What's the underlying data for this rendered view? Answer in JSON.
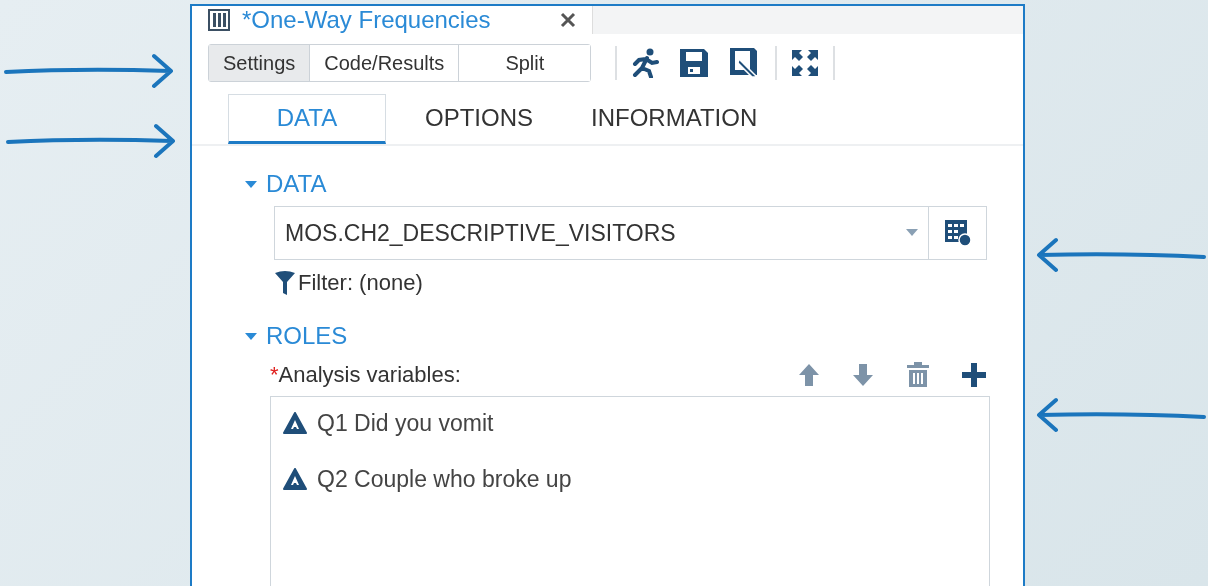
{
  "document_tab": {
    "title": "*One-Way Frequencies"
  },
  "view_buttons": [
    {
      "label": "Settings",
      "selected": true
    },
    {
      "label": "Code/Results",
      "selected": false
    },
    {
      "label": "Split",
      "selected": false
    }
  ],
  "tabs": [
    {
      "label": "DATA",
      "selected": true
    },
    {
      "label": "OPTIONS",
      "selected": false
    },
    {
      "label": "INFORMATION",
      "selected": false
    }
  ],
  "sections": [
    {
      "kind": "data",
      "title": "DATA",
      "expanded": true,
      "dataset": "MOS.CH2_DESCRIPTIVE_VISITORS",
      "filter": "Filter: (none)"
    },
    {
      "kind": "roles",
      "title": "ROLES",
      "expanded": true,
      "required_mark": "*",
      "label": "Analysis variables:",
      "variables": [
        "Q1 Did you vomit",
        "Q2 Couple who broke up"
      ]
    }
  ]
}
